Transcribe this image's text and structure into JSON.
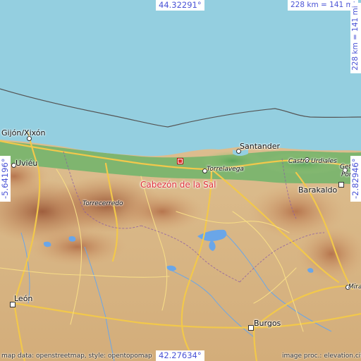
{
  "map": {
    "center_place": "Cabezón de la Sal",
    "colors": {
      "sea": "#94cfe0",
      "coast_green": "#5fa85f",
      "lowland": "#d8b88a",
      "mountain": "#b8704a",
      "road": "#f2c84b",
      "water": "#6aa6e8",
      "marker": "#e03030"
    },
    "places": [
      {
        "name": "Gijón/Xixón"
      },
      {
        "name": "Uviéu"
      },
      {
        "name": "Santander"
      },
      {
        "name": "Torrelavega"
      },
      {
        "name": "Castro Urdiales"
      },
      {
        "name": "Getxo"
      },
      {
        "name": "Por"
      },
      {
        "name": "Barakaldo"
      },
      {
        "name": "Torrecerredo"
      },
      {
        "name": "León"
      },
      {
        "name": "Burgos"
      },
      {
        "name": "Mira"
      }
    ],
    "coords": {
      "top_lat": "44.32291°",
      "bottom_lat": "42.27634°",
      "left_lon": "-5.64196°",
      "right_lon": "-2.82946°"
    },
    "scale": "228 km = 141 mi",
    "credits": {
      "left": "map data: openstreetmap, style: opentopomap",
      "right": "image proc.: elevation.city"
    }
  }
}
